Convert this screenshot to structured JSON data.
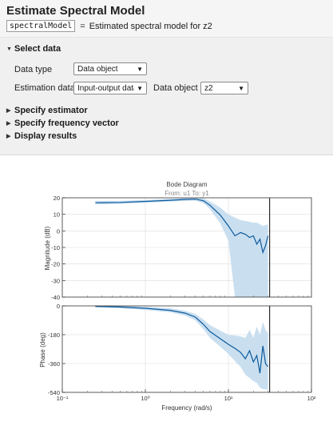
{
  "header": {
    "title": "Estimate Spectral Model",
    "variable_name": "spectralModel",
    "equals": "=",
    "description": "Estimated spectral model for z2"
  },
  "sections": {
    "select_data": {
      "label": "Select data",
      "expanded": true
    },
    "specify_estimator": {
      "label": "Specify estimator",
      "expanded": false
    },
    "specify_frequency": {
      "label": "Specify frequency vector",
      "expanded": false
    },
    "display_results": {
      "label": "Display results",
      "expanded": false
    }
  },
  "select_data": {
    "data_type_label": "Data type",
    "data_type_value": "Data object",
    "estimation_data_label": "Estimation data:",
    "estimation_data_value": "Input-output data",
    "data_object_label": "Data object",
    "data_object_value": "z2"
  },
  "colors": {
    "line": "#0d5a9c",
    "band": "#c9dff0",
    "panel": "#f0f0f0"
  },
  "chart_data": {
    "type": "line",
    "title": "Bode Diagram",
    "subtitle": "From: u1  To: y1",
    "xlabel": "Frequency  (rad/s)",
    "xscale": "log",
    "xlim": [
      0.1,
      100
    ],
    "nyquist_line": 31.4,
    "magnitude": {
      "ylabel": "Magnitude (dB)",
      "ylim": [
        -40,
        20
      ],
      "yticks": [
        20,
        10,
        0,
        -10,
        -20,
        -30,
        -40
      ],
      "x": [
        0.25,
        0.5,
        1,
        2,
        3,
        4,
        5,
        6,
        8,
        10,
        12,
        14,
        16,
        18,
        20,
        22,
        24,
        26,
        28,
        30
      ],
      "y": [
        17,
        17.2,
        17.8,
        18.5,
        19,
        19.2,
        18.2,
        15.5,
        9.5,
        3,
        -3,
        -1,
        -2,
        -4,
        -3,
        -8,
        -5,
        -13,
        -9,
        -3
      ],
      "band_low": [
        16,
        16.3,
        17,
        17.7,
        18.2,
        18.3,
        16.8,
        13.2,
        4.5,
        -6,
        -40,
        -40,
        -40,
        -40,
        -40,
        -40,
        -40,
        -40,
        -40,
        -40
      ],
      "band_high": [
        18.1,
        18.2,
        18.7,
        19.4,
        19.9,
        20.2,
        19.6,
        17.8,
        14,
        10,
        8,
        6.5,
        6,
        5.5,
        5,
        5,
        4,
        3,
        3.5,
        4
      ]
    },
    "phase": {
      "ylabel": "Phase (deg)",
      "ylim": [
        -540,
        0
      ],
      "yticks": [
        0,
        -180,
        -360,
        -540
      ],
      "x": [
        0.25,
        0.5,
        1,
        2,
        3,
        4,
        5,
        6,
        8,
        10,
        12,
        14,
        16,
        18,
        20,
        22,
        24,
        26,
        28,
        30
      ],
      "y": [
        -3,
        -7,
        -15,
        -28,
        -45,
        -70,
        -115,
        -160,
        -205,
        -240,
        -265,
        -290,
        -330,
        -280,
        -350,
        -310,
        -420,
        -250,
        -360,
        -380
      ],
      "band_low": [
        -10,
        -15,
        -25,
        -40,
        -60,
        -90,
        -145,
        -200,
        -255,
        -300,
        -345,
        -380,
        -430,
        -450,
        -470,
        -480,
        -510,
        -520,
        -520,
        -525
      ],
      "band_high": [
        0,
        0,
        -5,
        -15,
        -30,
        -50,
        -85,
        -120,
        -155,
        -180,
        -185,
        -190,
        -200,
        -150,
        -200,
        -130,
        -180,
        -100,
        -150,
        -170
      ]
    }
  },
  "axis_ticks": {
    "x_labels": [
      "10⁻¹",
      "10⁰",
      "10¹",
      "10²"
    ]
  }
}
